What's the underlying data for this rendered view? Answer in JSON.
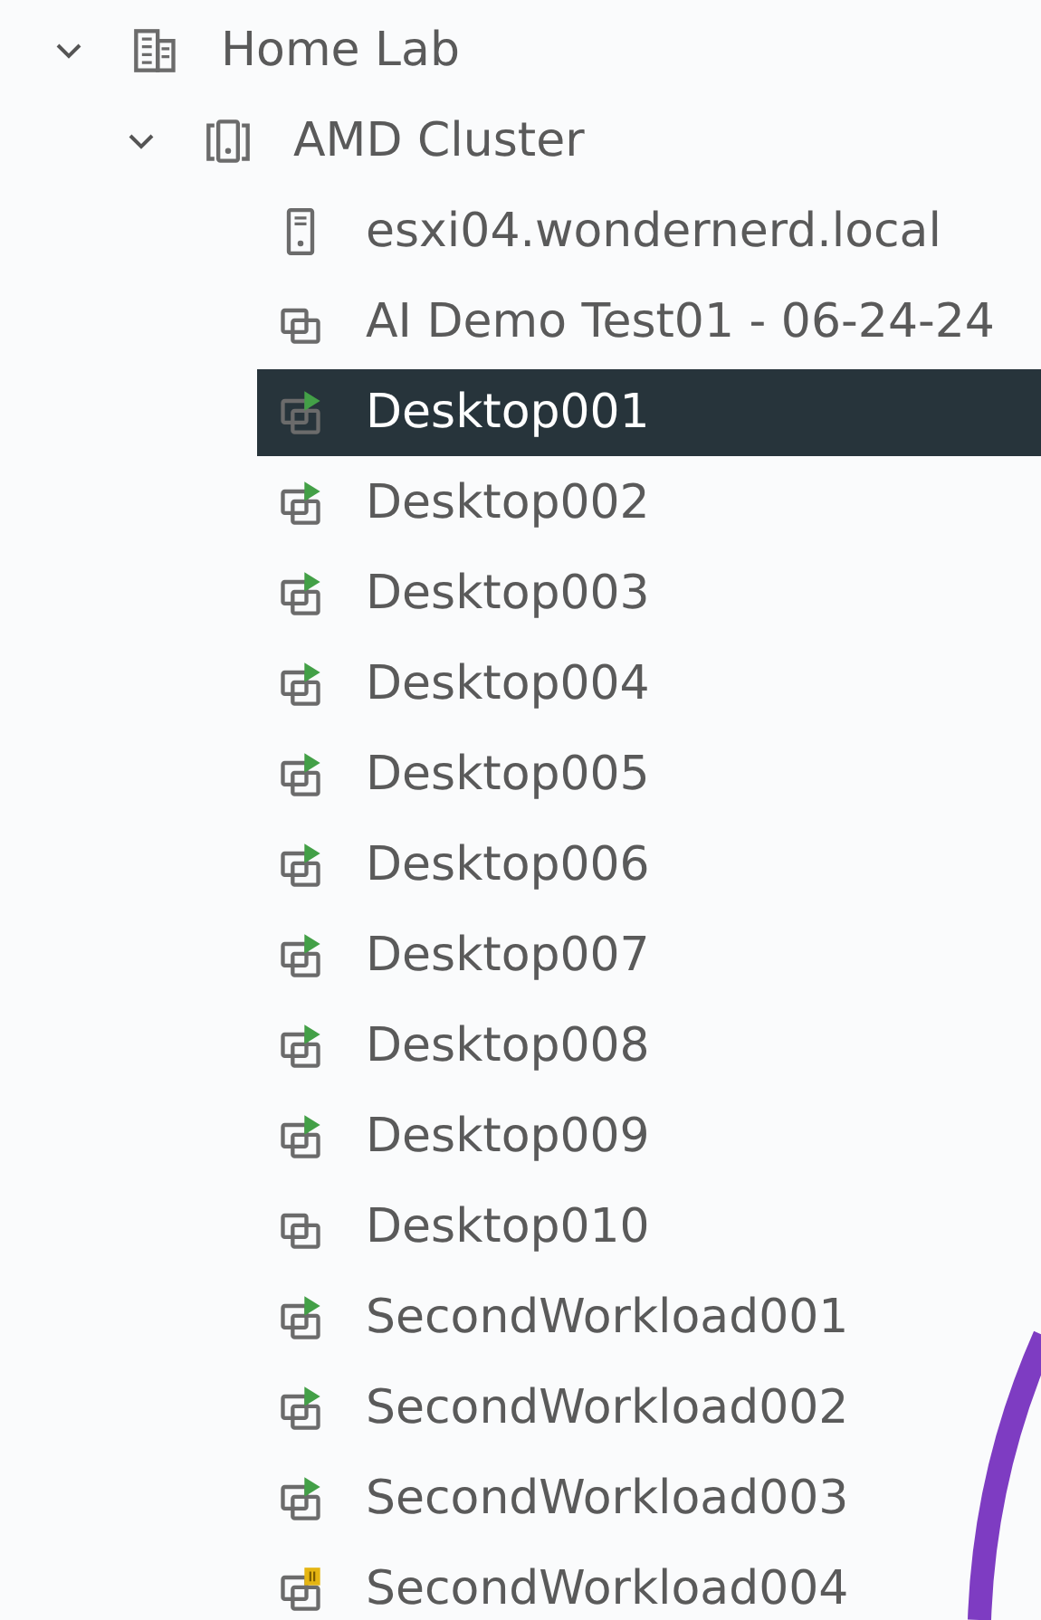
{
  "tree": [
    {
      "label": "Home Lab",
      "kind": "datacenter",
      "expanded": true,
      "selected": false,
      "children": [
        {
          "label": "AMD Cluster",
          "kind": "cluster",
          "expanded": true,
          "selected": false,
          "children": [
            {
              "label": "esxi04.wondernerd.local",
              "kind": "host",
              "selected": false
            },
            {
              "label": "AI Demo Test01 - 06-24-24",
              "kind": "vm",
              "powered_on": false,
              "suspended": false,
              "selected": false
            },
            {
              "label": "Desktop001",
              "kind": "vm",
              "powered_on": true,
              "suspended": false,
              "selected": true
            },
            {
              "label": "Desktop002",
              "kind": "vm",
              "powered_on": true,
              "suspended": false,
              "selected": false
            },
            {
              "label": "Desktop003",
              "kind": "vm",
              "powered_on": true,
              "suspended": false,
              "selected": false
            },
            {
              "label": "Desktop004",
              "kind": "vm",
              "powered_on": true,
              "suspended": false,
              "selected": false
            },
            {
              "label": "Desktop005",
              "kind": "vm",
              "powered_on": true,
              "suspended": false,
              "selected": false
            },
            {
              "label": "Desktop006",
              "kind": "vm",
              "powered_on": true,
              "suspended": false,
              "selected": false
            },
            {
              "label": "Desktop007",
              "kind": "vm",
              "powered_on": true,
              "suspended": false,
              "selected": false
            },
            {
              "label": "Desktop008",
              "kind": "vm",
              "powered_on": true,
              "suspended": false,
              "selected": false
            },
            {
              "label": "Desktop009",
              "kind": "vm",
              "powered_on": true,
              "suspended": false,
              "selected": false
            },
            {
              "label": "Desktop010",
              "kind": "vm",
              "powered_on": false,
              "suspended": false,
              "selected": false
            },
            {
              "label": "SecondWorkload001",
              "kind": "vm",
              "powered_on": true,
              "suspended": false,
              "selected": false
            },
            {
              "label": "SecondWorkload002",
              "kind": "vm",
              "powered_on": true,
              "suspended": false,
              "selected": false
            },
            {
              "label": "SecondWorkload003",
              "kind": "vm",
              "powered_on": true,
              "suspended": false,
              "selected": false
            },
            {
              "label": "SecondWorkload004",
              "kind": "vm",
              "powered_on": false,
              "suspended": true,
              "selected": false
            }
          ]
        }
      ]
    }
  ]
}
